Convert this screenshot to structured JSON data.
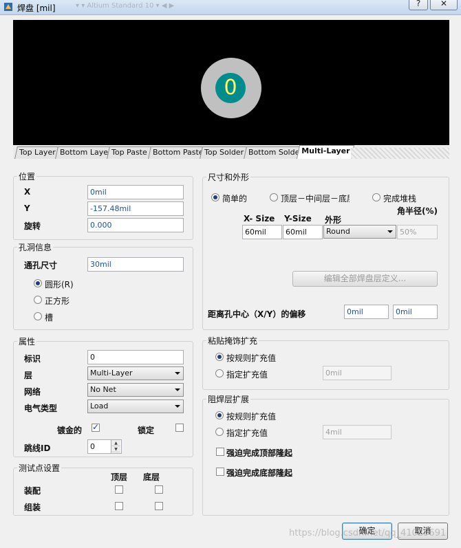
{
  "window": {
    "title": "焊盘 [mil]",
    "bg_toolbar_text": "▾  ▾  Altium Standard 10  ▾  ◀  ▶",
    "help_label": "?",
    "close_label": "✕"
  },
  "preview": {
    "pad_label": "0",
    "pad_outer_color": "#c0c0c0",
    "pad_inner_color": "#008c8c"
  },
  "layer_tabs": [
    "Top Layer",
    "Bottom Layer",
    "Top Paste",
    "Bottom Paste",
    "Top Solder",
    "Bottom Solder",
    "Multi-Layer"
  ],
  "active_tab": "Multi-Layer",
  "position": {
    "title": "位置",
    "x_label": "X",
    "x_value": "0mil",
    "y_label": "Y",
    "y_value": "-157.48mil",
    "rotation_label": "旋转",
    "rotation_value": "0.000"
  },
  "hole": {
    "title": "孔洞信息",
    "size_label": "通孔尺寸",
    "size_value": "30mil",
    "shapes": [
      {
        "label": "圆形(R)",
        "checked": true
      },
      {
        "label": "正方形",
        "checked": false
      },
      {
        "label": "槽",
        "checked": false
      }
    ]
  },
  "properties": {
    "title": "属性",
    "designator_label": "标识",
    "designator_value": "0",
    "layer_label": "层",
    "layer_value": "Multi-Layer",
    "net_label": "网络",
    "net_value": "No Net",
    "elec_type_label": "电气类型",
    "elec_type_value": "Load",
    "plated_label": "镀金的",
    "plated_checked": true,
    "locked_label": "锁定",
    "locked_checked": false,
    "jumper_label": "跳线ID",
    "jumper_value": "0"
  },
  "testpoint": {
    "title": "测试点设置",
    "col_top": "顶层",
    "col_bottom": "底层",
    "assembly_label": "装配",
    "fabrication_label": "组装"
  },
  "size_shape": {
    "title": "尺寸和外形",
    "radio_simple": "简单的",
    "radio_tmb": "顶层－中间层－底层",
    "radio_full": "完成堆栈",
    "corner_radius_header": "角半径(%)",
    "col_x": "X- Size",
    "col_y": "Y-Size",
    "col_shape": "外形",
    "x_size": "60mil",
    "y_size": "60mil",
    "shape": "Round",
    "corner_radius": "50%",
    "edit_button": "编辑全部焊盘层定义...",
    "offset_label": "距离孔中心（X/Y）的偏移",
    "offset_x": "0mil",
    "offset_y": "0mil"
  },
  "paste_mask": {
    "title": "粘贴掩饰扩充",
    "rule_label": "按规则扩充值",
    "specify_label": "指定扩充值",
    "value": "0mil"
  },
  "solder_mask": {
    "title": "阻焊层扩展",
    "rule_label": "按规则扩充值",
    "specify_label": "指定扩充值",
    "value": "4mil",
    "force_top_label": "强迫完成顶部隆起",
    "force_bottom_label": "强迫完成底部隆起"
  },
  "footer": {
    "ok_label": "确定",
    "cancel_label": "取消",
    "watermark": "https://blog.csdn.net/qq_41025691"
  }
}
